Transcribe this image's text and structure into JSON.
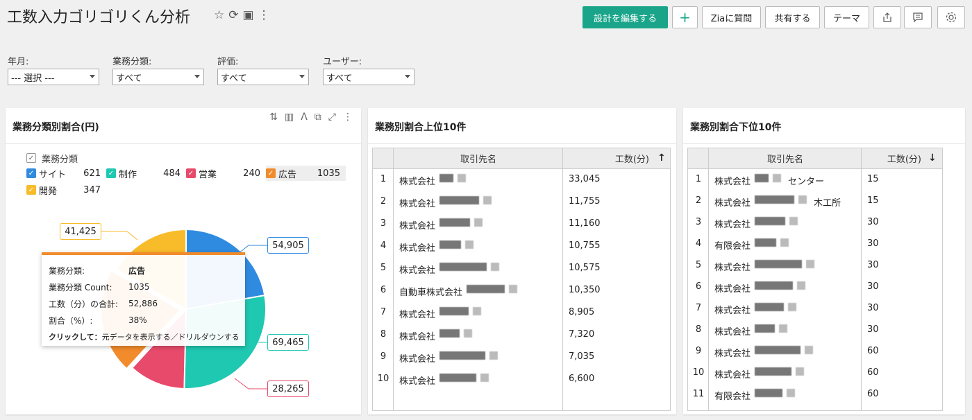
{
  "header": {
    "title": "工数入力ゴリゴリくん分析",
    "edit_design": "設計を編集する",
    "add": "+",
    "zia": "Ziaに質問",
    "share": "共有する",
    "theme": "テーマ",
    "icons": [
      "star-icon",
      "refresh-icon",
      "save-icon",
      "more-icon",
      "export-icon",
      "comment-icon",
      "settings-icon"
    ]
  },
  "filters": [
    {
      "label": "年月:",
      "value": "--- 選択 ---"
    },
    {
      "label": "業務分類:",
      "value": "すべて"
    },
    {
      "label": "評価:",
      "value": "すべて"
    },
    {
      "label": "ユーザー:",
      "value": "すべて"
    }
  ],
  "pie_panel": {
    "title": "業務分類別割合(円)",
    "legend_title": "業務分類",
    "legend": [
      {
        "name": "サイト",
        "count": "621",
        "color": "#2f8be0"
      },
      {
        "name": "制作",
        "count": "484",
        "color": "#1fc8b1"
      },
      {
        "name": "営業",
        "count": "240",
        "color": "#e84a6b"
      },
      {
        "name": "広告",
        "count": "1035",
        "color": "#f28b2b"
      },
      {
        "name": "開発",
        "count": "347",
        "color": "#f8bb2a"
      }
    ],
    "callouts": [
      "41,425",
      "54,905",
      "69,465",
      "28,265"
    ],
    "tooltip": {
      "k1": "業務分類:",
      "v1": "広告",
      "k2": "業務分類 Count:",
      "v2": "1035",
      "k3": "工数（分）の合計:",
      "v3": "52,886",
      "k4": "割合（%）:",
      "v4": "38%",
      "click_bold": "クリックして：",
      "click_rest": "元データを表示する／ドリルダウンする"
    }
  },
  "chart_data": {
    "type": "pie",
    "title": "業務分類別割合(円)",
    "categories": [
      "サイト",
      "制作",
      "営業",
      "広告",
      "開発"
    ],
    "values": [
      54905,
      69465,
      28265,
      52886,
      41425
    ],
    "counts": [
      621,
      484,
      240,
      1035,
      347
    ]
  },
  "top_panel": {
    "title_pre": "業務別割合上位",
    "title_bold": "10件",
    "col_name": "取引先名",
    "col_val": "工数(分)",
    "sort": "↑",
    "rows": [
      {
        "n": "1",
        "name": "株式会社",
        "v": "33,045"
      },
      {
        "n": "2",
        "name": "株式会社",
        "v": "11,755"
      },
      {
        "n": "3",
        "name": "株式会社",
        "v": "11,160"
      },
      {
        "n": "4",
        "name": "株式会社",
        "v": "10,755"
      },
      {
        "n": "5",
        "name": "株式会社",
        "v": "10,575"
      },
      {
        "n": "6",
        "name": "自動車株式会社",
        "v": "10,350"
      },
      {
        "n": "7",
        "name": "株式会社",
        "v": "8,905"
      },
      {
        "n": "8",
        "name": "株式会社",
        "v": "7,320"
      },
      {
        "n": "9",
        "name": "株式会社",
        "v": "7,035"
      },
      {
        "n": "10",
        "name": "株式会社",
        "v": "6,600"
      }
    ]
  },
  "bottom_panel": {
    "title_pre": "業務別割合下位",
    "title_bold": "10件",
    "col_name": "取引先名",
    "col_val": "工数(分)",
    "sort": "↓",
    "rows": [
      {
        "n": "1",
        "name": "株式会社",
        "tail": "センター",
        "v": "15"
      },
      {
        "n": "2",
        "name": "株式会社",
        "tail": "木工所",
        "v": "15"
      },
      {
        "n": "3",
        "name": "株式会社",
        "tail": "",
        "v": "30"
      },
      {
        "n": "4",
        "name": "有限会社",
        "tail": "",
        "v": "30"
      },
      {
        "n": "5",
        "name": "株式会社",
        "tail": "",
        "v": "30"
      },
      {
        "n": "6",
        "name": "株式会社",
        "tail": "",
        "v": "30"
      },
      {
        "n": "7",
        "name": "株式会社",
        "tail": "",
        "v": "30"
      },
      {
        "n": "8",
        "name": "株式会社",
        "tail": "",
        "v": "30"
      },
      {
        "n": "9",
        "name": "株式会社",
        "tail": "",
        "v": "60"
      },
      {
        "n": "10",
        "name": "株式会社",
        "tail": "",
        "v": "60"
      },
      {
        "n": "11",
        "name": "有限会社",
        "tail": "",
        "v": "60"
      }
    ]
  }
}
